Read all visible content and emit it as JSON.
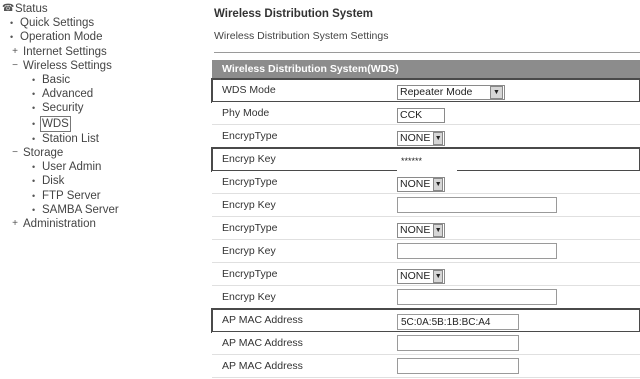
{
  "sidebar": {
    "items": [
      {
        "label": "Status",
        "glyph": "☎",
        "level": 0
      },
      {
        "label": "Quick Settings",
        "glyph": "•",
        "level": 1
      },
      {
        "label": "Operation Mode",
        "glyph": "•",
        "level": 1
      },
      {
        "label": "Internet Settings",
        "glyph": "+",
        "level": 1
      },
      {
        "label": "Wireless Settings",
        "glyph": "−",
        "level": 1
      },
      {
        "label": "Basic",
        "glyph": "•",
        "level": 2
      },
      {
        "label": "Advanced",
        "glyph": "•",
        "level": 2
      },
      {
        "label": "Security",
        "glyph": "•",
        "level": 2
      },
      {
        "label": "WDS",
        "glyph": "•",
        "level": 2,
        "active": true
      },
      {
        "label": "Station List",
        "glyph": "•",
        "level": 2
      },
      {
        "label": "Storage",
        "glyph": "−",
        "level": 1
      },
      {
        "label": "User Admin",
        "glyph": "•",
        "level": 2
      },
      {
        "label": "Disk",
        "glyph": "•",
        "level": 2
      },
      {
        "label": "FTP Server",
        "glyph": "•",
        "level": 2
      },
      {
        "label": "SAMBA Server",
        "glyph": "•",
        "level": 2
      },
      {
        "label": "Administration",
        "glyph": "+",
        "level": 1
      }
    ]
  },
  "main": {
    "title": "Wireless Distribution System",
    "subtitle": "Wireless Distribution System Settings",
    "section_header": "Wireless Distribution System(WDS)",
    "rows": [
      {
        "label": "WDS Mode",
        "type": "select",
        "value": "Repeater Mode"
      },
      {
        "label": "Phy Mode",
        "type": "select",
        "value": "CCK"
      },
      {
        "label": "EncrypType",
        "type": "select",
        "value": "NONE"
      },
      {
        "label": "Encryp Key",
        "type": "masked",
        "value": "******"
      },
      {
        "label": "EncrypType",
        "type": "select",
        "value": "NONE"
      },
      {
        "label": "Encryp Key",
        "type": "text",
        "value": ""
      },
      {
        "label": "EncrypType",
        "type": "select",
        "value": "NONE"
      },
      {
        "label": "Encryp Key",
        "type": "text",
        "value": ""
      },
      {
        "label": "EncrypType",
        "type": "select",
        "value": "NONE"
      },
      {
        "label": "Encryp Key",
        "type": "text",
        "value": ""
      },
      {
        "label": "AP MAC Address",
        "type": "mac",
        "value": "5C:0A:5B:1B:BC:A4"
      },
      {
        "label": "AP MAC Address",
        "type": "mac",
        "value": ""
      },
      {
        "label": "AP MAC Address",
        "type": "mac",
        "value": ""
      }
    ]
  },
  "icons": {
    "dropdown_arrow": "▼"
  },
  "colors": {
    "section_header_bg": "#8c8c8c",
    "highlight_outline": "#4a4a4a"
  }
}
